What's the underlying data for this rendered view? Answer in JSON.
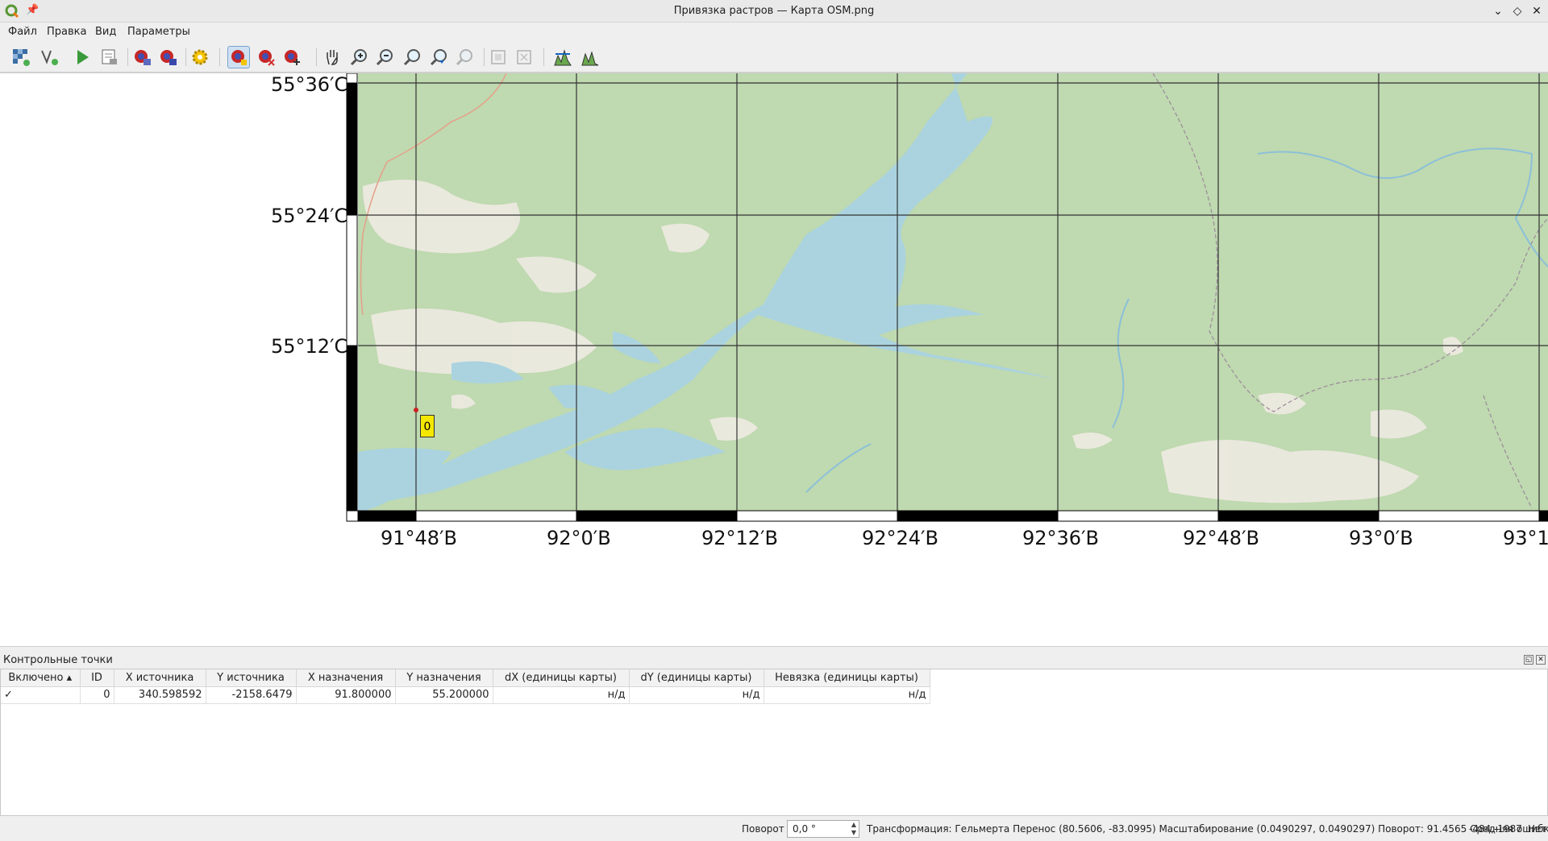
{
  "window": {
    "title": "Привязка растров — Карта OSM.png"
  },
  "menu": [
    "Файл",
    "Правка",
    "Вид",
    "Параметры"
  ],
  "toolbar": {
    "icons": [
      "open-raster-icon",
      "start-georeferencing-icon",
      "generate-gdal-script-icon",
      "load-gcp-icon",
      "save-gcp-icon",
      "transformation-settings-icon",
      "add-point-icon",
      "delete-point-icon",
      "move-point-icon",
      "pan-icon",
      "zoom-in-icon",
      "zoom-out-icon",
      "zoom-to-layer-icon",
      "zoom-last-icon",
      "zoom-next-icon",
      "link-georef-to-qgis-icon",
      "link-qgis-to-georef-icon",
      "full-histogram-stretch-icon",
      "local-histogram-stretch-icon"
    ]
  },
  "map": {
    "lat_labels": [
      "55°36′С",
      "55°24′С",
      "55°12′С"
    ],
    "lon_labels": [
      "91°48′В",
      "92°0′В",
      "92°12′В",
      "92°24′В",
      "92°36′В",
      "92°48′В",
      "93°0′В",
      "93°1"
    ],
    "gcp_marker_id": "0",
    "colors": {
      "land": "#bfd9b0",
      "water": "#aad3df",
      "grid": "#333333",
      "frame": "#000000"
    }
  },
  "gcp_panel": {
    "title": "Контрольные точки",
    "columns": [
      "Включено",
      "ID",
      "X источника",
      "Y источника",
      "X назначения",
      "Y назначения",
      "dX (единицы карты)",
      "dY (единицы карты)",
      "Невязка (единицы карты)"
    ],
    "rows": [
      {
        "enabled": "✓",
        "id": "0",
        "src_x": "340.598592",
        "src_y": "-2158.6479",
        "dst_x": "91.800000",
        "dst_y": "55.200000",
        "dx": "н/д",
        "dy": "н/д",
        "residual": "н/д"
      }
    ]
  },
  "status": {
    "rotation_label": "Поворот",
    "rotation_value": "0,0 °",
    "transform_text": "Трансформация: Гельмерта Перенос (80.5606, -83.0995) Масштабирование (0.0490297, 0.0490297) Поворот: 91.4565 Средняя ошибка: 0",
    "coords": "-484,-1987",
    "crs": "Нет"
  }
}
